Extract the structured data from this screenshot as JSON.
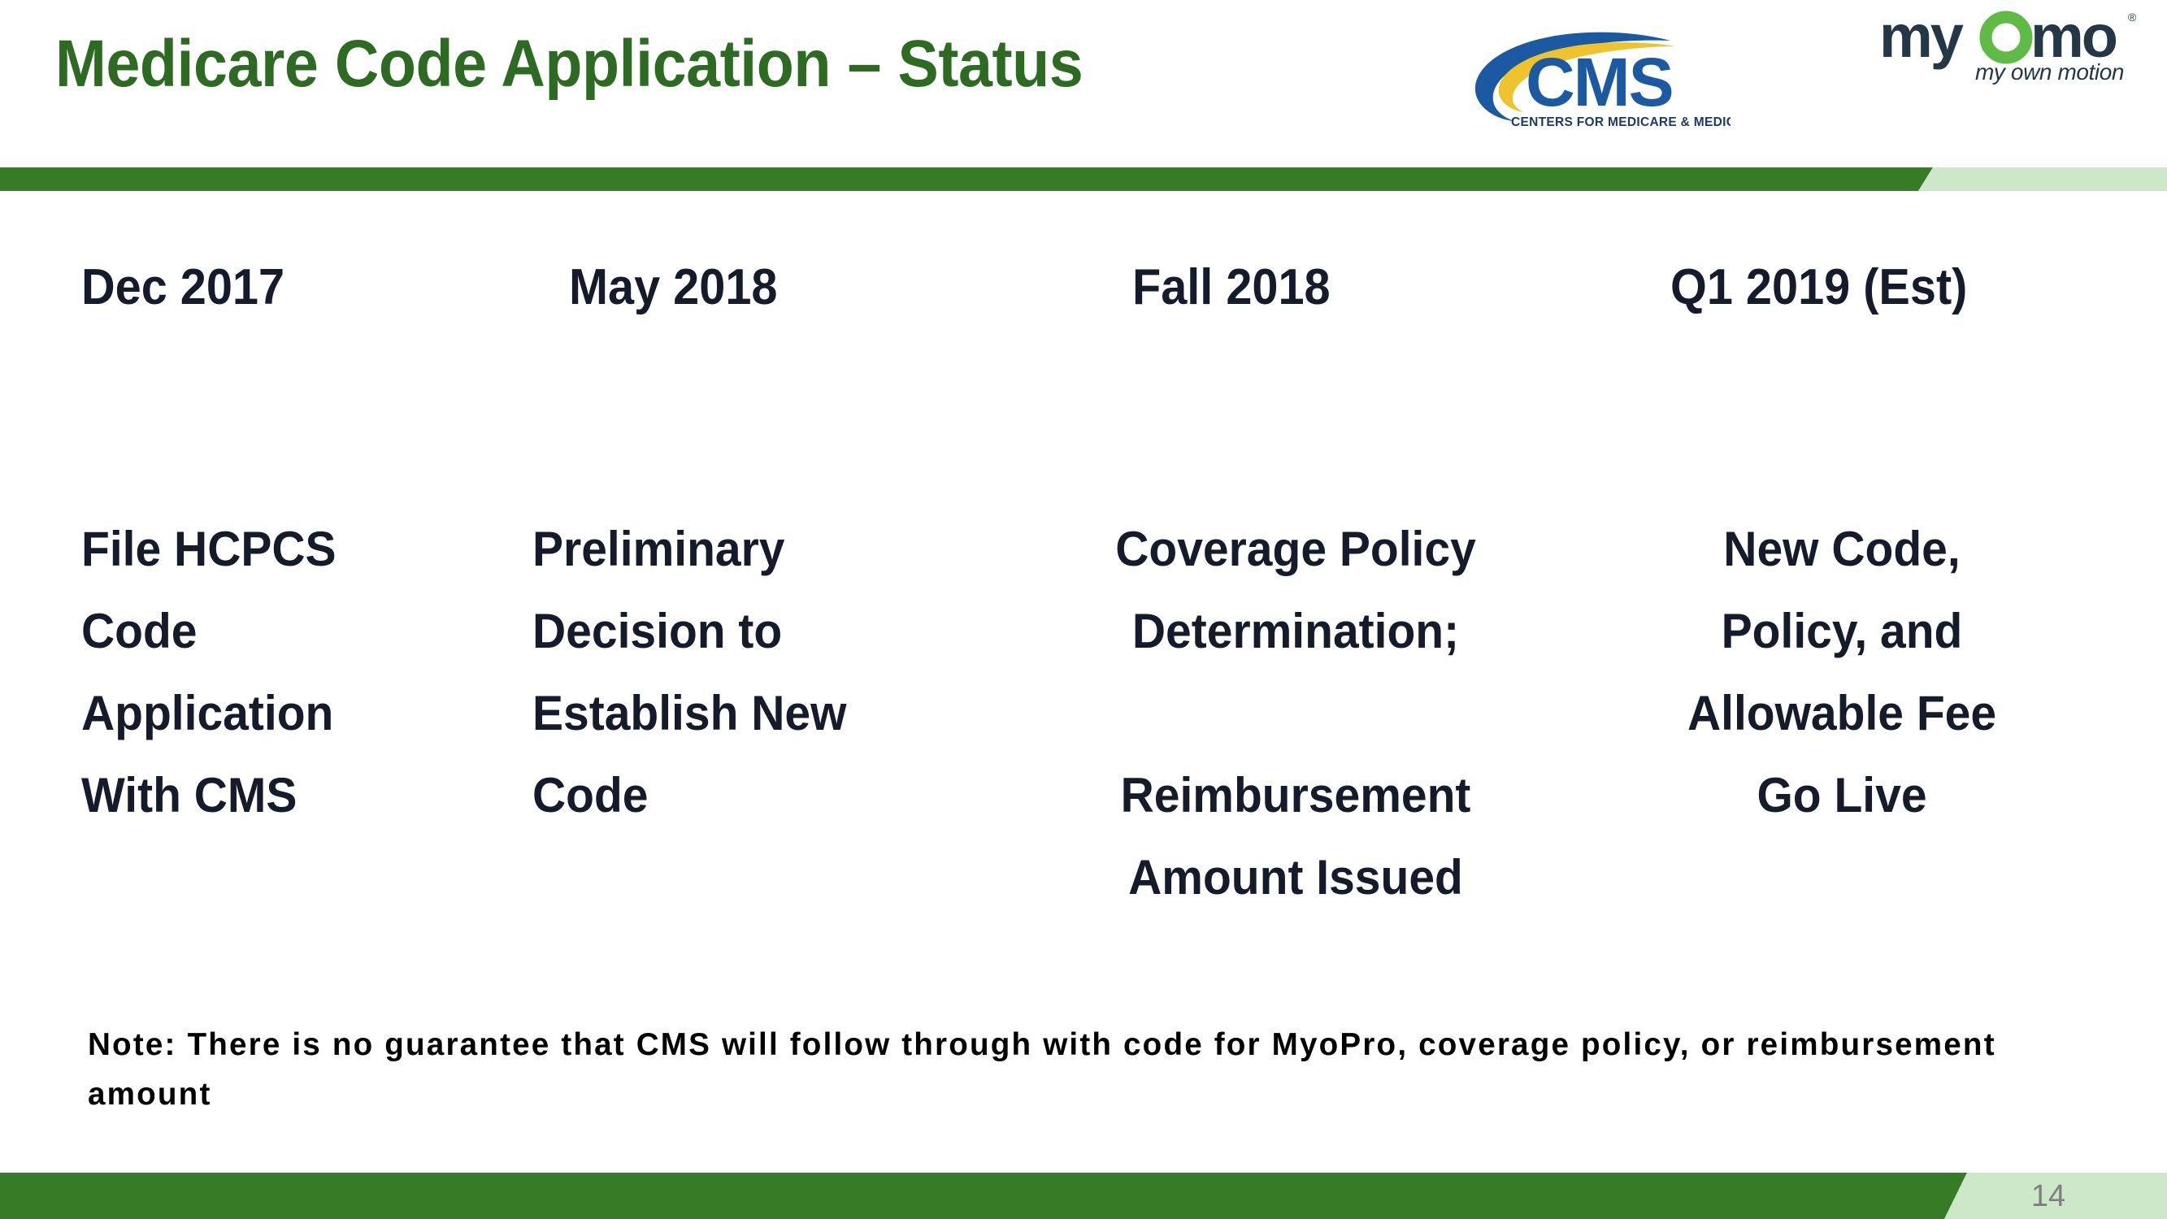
{
  "slide": {
    "title": "Medicare Code Application – Status",
    "page_number": "14",
    "title_color": "#2E6B22",
    "bar_dark_green": "#367C27",
    "bar_light_green": "#CCE8C8",
    "body_text_color": "#151B2B"
  },
  "logos": {
    "cms": {
      "name": "CMS",
      "wordmark": "CMS",
      "tagline": "CENTERS FOR MEDICARE & MEDICAID SERVICES",
      "blue": "#1B5AA3",
      "gold": "#EFC32E"
    },
    "myomo": {
      "name": "myomo",
      "wordmark": "myomo",
      "tagline": "my own motion",
      "registered_mark": "®",
      "navy": "#233747",
      "green": "#5FBB46"
    }
  },
  "timeline": {
    "columns": [
      {
        "heading": "Dec 2017",
        "lines": [
          "File HCPCS",
          "Code",
          "Application",
          "With CMS"
        ]
      },
      {
        "heading": "May 2018",
        "lines": [
          "Preliminary",
          "Decision to",
          "Establish New",
          "Code"
        ]
      },
      {
        "heading": "Fall 2018",
        "lines": [
          "Coverage Policy",
          "Determination;",
          "",
          "Reimbursement",
          "Amount Issued"
        ]
      },
      {
        "heading": "Q1 2019 (Est)",
        "lines": [
          "New Code,",
          "Policy, and",
          "Allowable Fee",
          "Go Live"
        ]
      }
    ]
  },
  "note": {
    "text": "Note: There is no guarantee that CMS will follow through with code for MyoPro, coverage policy, or reimbursement amount"
  }
}
